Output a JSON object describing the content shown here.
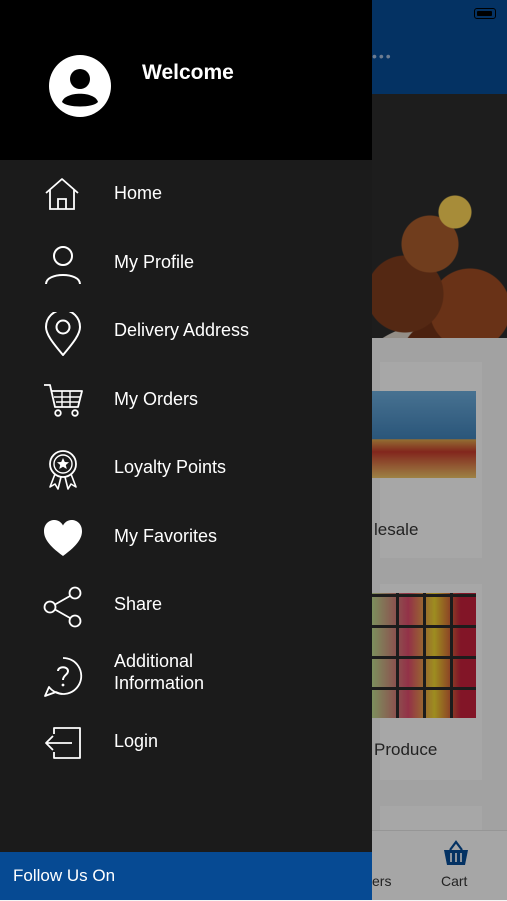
{
  "drawer": {
    "welcome": "Welcome",
    "menu": [
      {
        "label": "Home",
        "icon": "home-icon"
      },
      {
        "label": "My Profile",
        "icon": "user-icon"
      },
      {
        "label": "Delivery Address",
        "icon": "location-pin-icon"
      },
      {
        "label": "My Orders",
        "icon": "shopping-cart-icon"
      },
      {
        "label": "Loyalty Points",
        "icon": "award-badge-icon"
      },
      {
        "label": "My Favorites",
        "icon": "heart-icon"
      },
      {
        "label": "Share",
        "icon": "share-icon"
      },
      {
        "label_line1": "Additional",
        "label_line2": "Information",
        "icon": "help-question-icon"
      },
      {
        "label": "Login",
        "icon": "login-icon"
      }
    ],
    "footer_label": "Follow Us On"
  },
  "background": {
    "header_dots": "•••",
    "card_labels": [
      "lesale",
      "Produce"
    ],
    "tabs": {
      "left_partial": "ers",
      "cart": "Cart"
    }
  },
  "colors": {
    "accent_blue": "#064a93",
    "drawer_bg": "#1b1b1b",
    "header_bg": "#000000"
  }
}
